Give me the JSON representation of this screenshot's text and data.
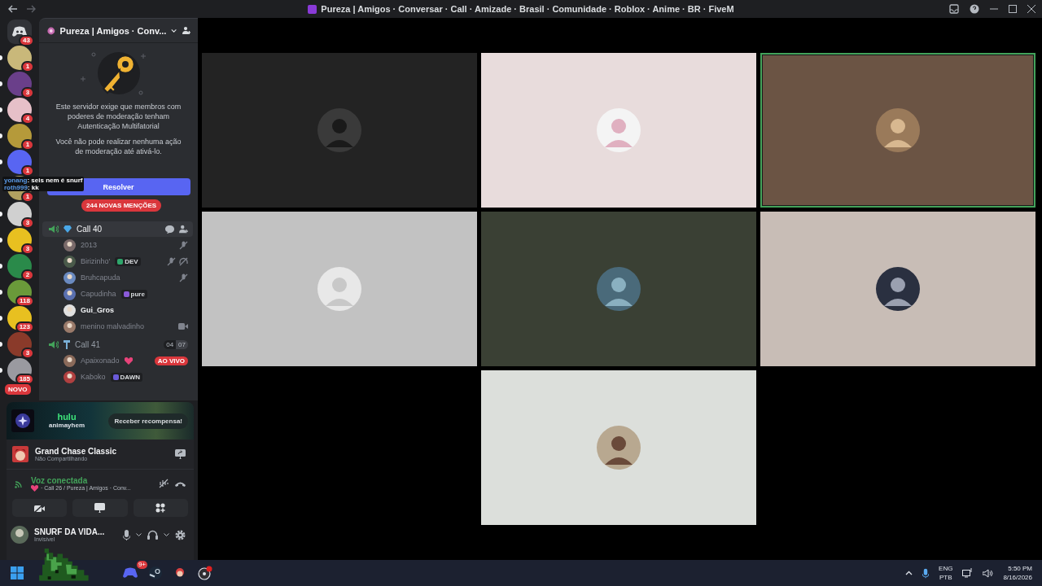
{
  "window": {
    "title": "Pureza | Amigos · Conversar · Call · Amizade · Brasil · Comunidade · Roblox · Anime · BR · FiveM"
  },
  "servers": [
    {
      "kind": "home",
      "badge": "43",
      "unread": false
    },
    {
      "kind": "server",
      "badge": "1",
      "unread": true
    },
    {
      "kind": "server",
      "badge": "3",
      "unread": true
    },
    {
      "kind": "server",
      "badge": "4",
      "unread": true
    },
    {
      "kind": "server",
      "badge": "1",
      "unread": true
    },
    {
      "kind": "server",
      "badge": "1",
      "unread": true
    },
    {
      "kind": "server",
      "badge": "1",
      "unread": false
    },
    {
      "kind": "server",
      "badge": "3",
      "unread": true
    },
    {
      "kind": "server",
      "badge": "3",
      "unread": true
    },
    {
      "kind": "server",
      "badge": "2",
      "unread": true
    },
    {
      "kind": "server",
      "badge": "118",
      "unread": true
    },
    {
      "kind": "server",
      "badge": "123",
      "unread": true
    },
    {
      "kind": "server",
      "badge": "3",
      "unread": true
    },
    {
      "kind": "server",
      "badge": "185",
      "unread": true
    }
  ],
  "new_pill": "NOVO",
  "chat_overlay": [
    {
      "user": "yonang",
      "text": ": seis nem é snurf"
    },
    {
      "user": "roth999",
      "text": ": kk"
    }
  ],
  "server_header": {
    "name": "Pureza | Amigos · Conv..."
  },
  "notice": {
    "text": "Este servidor exige que membros com poderes de moderação tenham Autenticação Multifatorial",
    "note": "Você não pode realizar nenhuma ação de moderação até ativá-lo.",
    "button": "Resolver"
  },
  "mentions_pill": "244 NOVAS MENÇÕES",
  "channels": [
    {
      "name": "Call 40",
      "selected": true,
      "members": [
        {
          "name": "2013",
          "muted": true,
          "deafened": false,
          "video": false,
          "heart": false,
          "highlighted": false
        },
        {
          "name": "Birizinho'",
          "tag": {
            "kind": "dev",
            "label": "DEV"
          },
          "muted": true,
          "deafened": true,
          "video": false,
          "heart": false,
          "highlighted": false
        },
        {
          "name": "Bruhcapuda",
          "muted": true,
          "deafened": false,
          "video": false,
          "heart": false,
          "highlighted": false
        },
        {
          "name": "Capudinha",
          "tag": {
            "kind": "pure",
            "label": "pure"
          },
          "muted": false,
          "deafened": false,
          "video": false,
          "heart": false,
          "highlighted": false
        },
        {
          "name": "Gui_Gros",
          "muted": false,
          "deafened": false,
          "video": false,
          "heart": false,
          "highlighted": true
        },
        {
          "name": "menino malvadinho",
          "muted": false,
          "deafened": false,
          "video": true,
          "heart": false,
          "highlighted": false
        }
      ]
    },
    {
      "name": "Call 41",
      "selected": false,
      "counts": [
        "04",
        "07"
      ],
      "members": [
        {
          "name": "Apaixonado",
          "live": "AO VIVO",
          "muted": false,
          "deafened": false,
          "video": false,
          "heart": true,
          "highlighted": false
        },
        {
          "name": "Kaboko",
          "tag": {
            "kind": "dawn",
            "label": "DAWN"
          },
          "muted": false,
          "deafened": false,
          "video": false,
          "heart": false,
          "highlighted": false
        }
      ]
    }
  ],
  "promo": {
    "brand": "hulu",
    "subtitle": "animayhem",
    "button": "Receber recompensa!"
  },
  "activity": {
    "title": "Grand Chase Classic",
    "subtitle": "Não Compartilhando"
  },
  "voice": {
    "status": "Voz conectada",
    "channel": "· Call 26 / Pureza | Amigos · Conv..."
  },
  "user": {
    "name": "SNURF DA VIDA...",
    "status": "Invisível"
  },
  "tiles": [
    {
      "color": "#232323",
      "speaking": false
    },
    {
      "color": "#e8dcdc",
      "speaking": false
    },
    {
      "color": "#6b5444",
      "speaking": true
    },
    {
      "color": "#c2c2c2",
      "speaking": false
    },
    {
      "color": "#3a4034",
      "speaking": false
    },
    {
      "color": "#c8bdb6",
      "speaking": false
    },
    {
      "color": "#dcdfdb",
      "speaking": false
    }
  ],
  "taskbar": {
    "discord_badge": "9+",
    "language": "ENG",
    "layout": "PTB",
    "time": "5:50 PM",
    "date": "8/16/2026"
  }
}
